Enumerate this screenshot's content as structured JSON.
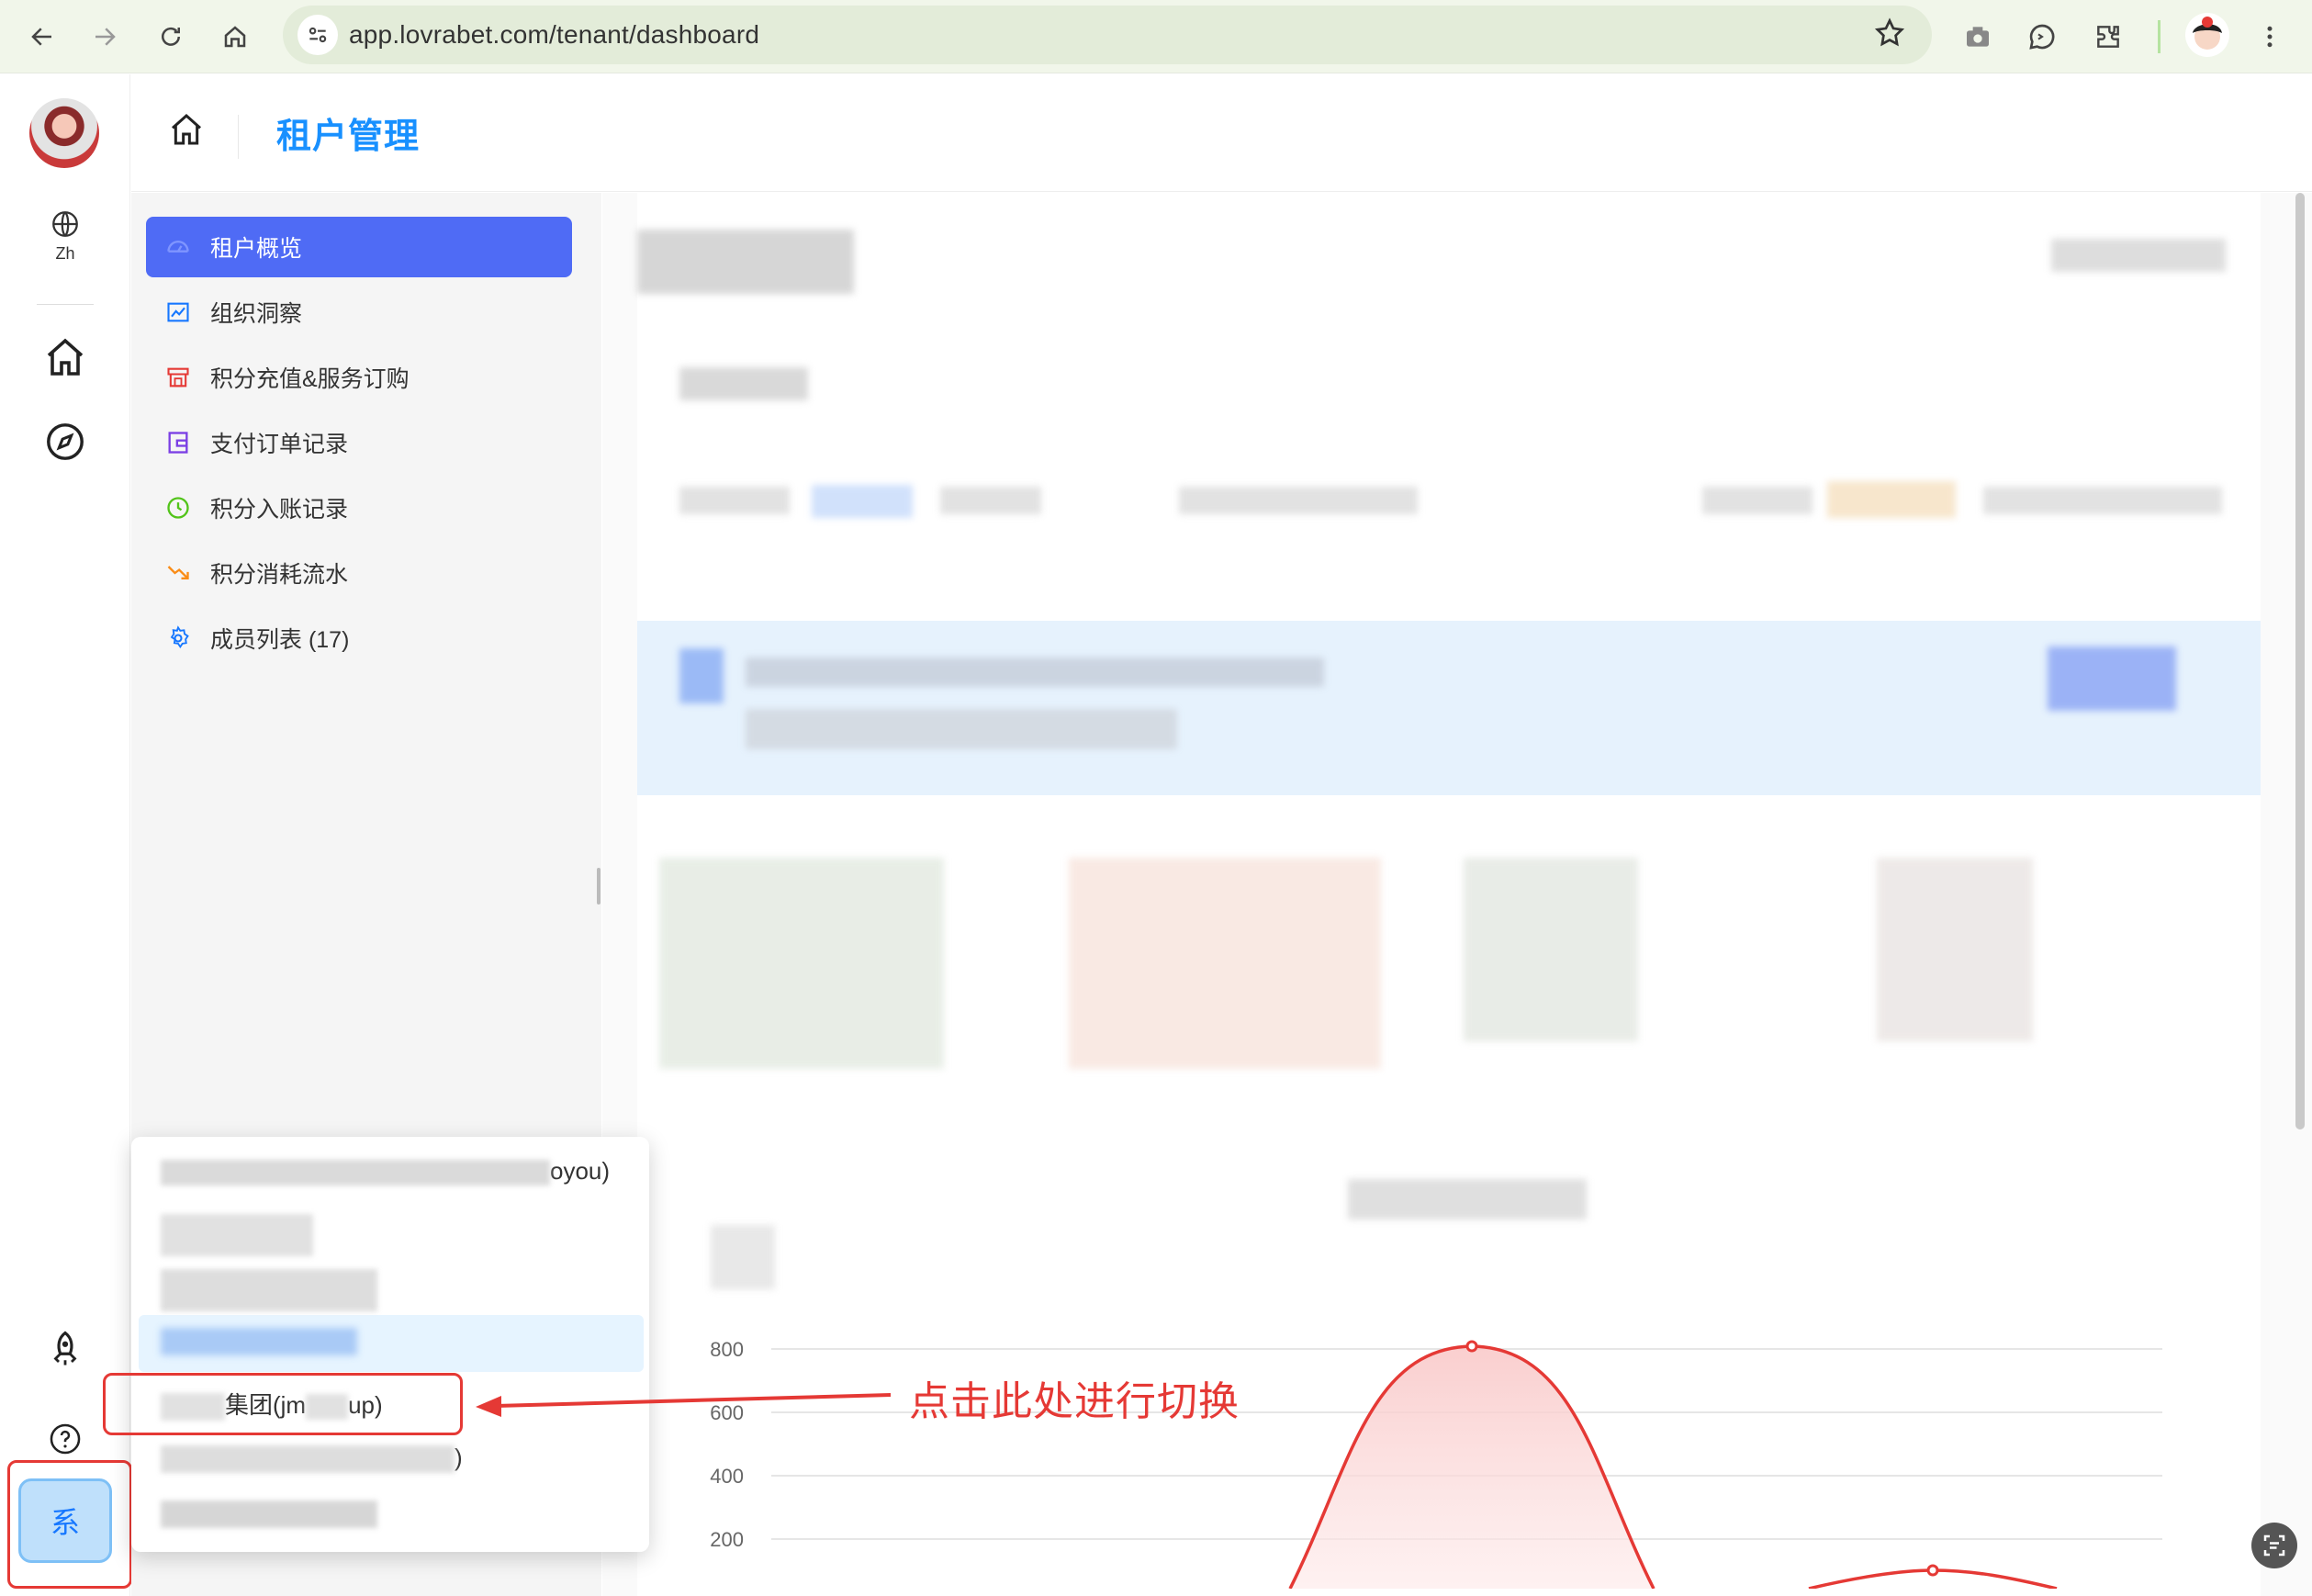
{
  "browser": {
    "url": "app.lovrabet.com/tenant/dashboard"
  },
  "rail": {
    "language_label": "Zh",
    "system_button_label": "系"
  },
  "header": {
    "title": "租户管理"
  },
  "sidebar": {
    "items": [
      {
        "label": "租户概览",
        "icon": "dashboard-icon",
        "color": "#ffffff"
      },
      {
        "label": "组织洞察",
        "icon": "line-chart-icon",
        "color": "#1677ff"
      },
      {
        "label": "积分充值&服务订购",
        "icon": "shop-icon",
        "color": "#e53935"
      },
      {
        "label": "支付订单记录",
        "icon": "wallet-icon",
        "color": "#7b3fe4"
      },
      {
        "label": "积分入账记录",
        "icon": "clock-icon",
        "color": "#52c41a"
      },
      {
        "label": "积分消耗流水",
        "icon": "trend-down-icon",
        "color": "#fa8c16"
      },
      {
        "label": "成员列表 (17)",
        "icon": "gear-icon",
        "color": "#1677ff"
      }
    ]
  },
  "dropdown": {
    "items": [
      {
        "label": "oyou)"
      },
      {
        "label": ""
      },
      {
        "label": ""
      },
      {
        "label": ""
      },
      {
        "label": "集团(jm",
        "label_tail": "up)"
      },
      {
        "label": ")"
      },
      {
        "label": ""
      }
    ]
  },
  "annotation": {
    "text": "点击此处进行切换"
  },
  "chart_data": {
    "type": "area",
    "y_ticks": [
      "800",
      "600",
      "400",
      "200"
    ],
    "series": [
      {
        "color": "#e53935"
      }
    ]
  },
  "colors": {
    "accent": "#4f6bf5",
    "title_blue": "#1890ff",
    "annotation_red": "#e53935"
  }
}
